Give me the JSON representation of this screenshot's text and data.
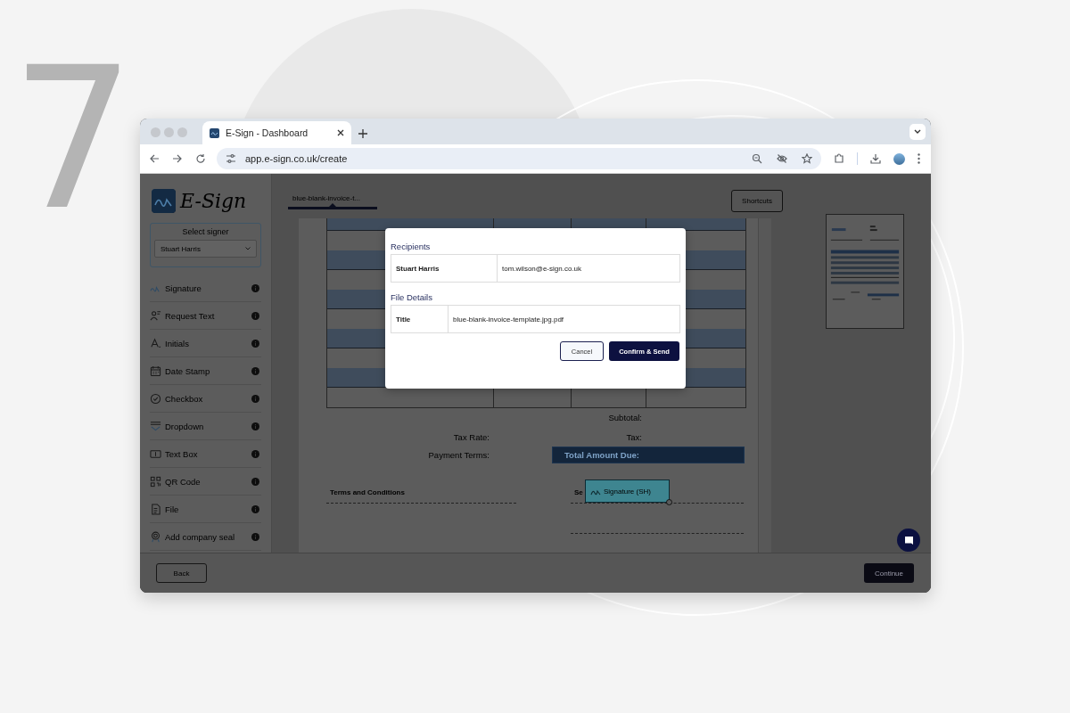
{
  "step_number": "7",
  "browser": {
    "tab_title": "E-Sign - Dashboard",
    "url": "app.e-sign.co.uk/create"
  },
  "sidebar": {
    "logo": "E-Sign",
    "signer_label": "Select signer",
    "signer_value": "Stuart Harris",
    "tools": [
      {
        "kind": "signature",
        "label": "Signature"
      },
      {
        "kind": "request_text",
        "label": "Request Text"
      },
      {
        "kind": "initials",
        "label": "Initials"
      },
      {
        "kind": "date_stamp",
        "label": "Date Stamp"
      },
      {
        "kind": "checkbox",
        "label": "Checkbox"
      },
      {
        "kind": "dropdown",
        "label": "Dropdown"
      },
      {
        "kind": "text_box",
        "label": "Text Box"
      },
      {
        "kind": "qr_code",
        "label": "QR Code"
      },
      {
        "kind": "file",
        "label": "File"
      },
      {
        "kind": "company_seal",
        "label": "Add company seal"
      }
    ]
  },
  "document": {
    "tabs": [
      {
        "label": "blue-blank-invoice-t...",
        "selected": true
      }
    ],
    "shortcuts_button": "Shortcuts",
    "subtotal_label": "Subtotal:",
    "tax_rate_label": "Tax Rate:",
    "tax_label": "Tax:",
    "payment_terms_label": "Payment Terms:",
    "total_label": "Total Amount Due:",
    "terms_heading": "Terms and Conditions",
    "signature_heading": "Se",
    "signature_field": "Signature (SH)"
  },
  "modal": {
    "recipients_heading": "Recipients",
    "recipients": [
      {
        "name": "Stuart Harris",
        "email": "tom.wilson@e-sign.co.uk"
      }
    ],
    "file_heading": "File Details",
    "file_details": [
      {
        "label": "Title",
        "value": "blue-blank-invoice-template.jpg.pdf"
      }
    ],
    "cancel_button": "Cancel",
    "confirm_button": "Confirm & Send"
  },
  "footer": {
    "back_button": "Back",
    "continue_button": "Continue"
  }
}
